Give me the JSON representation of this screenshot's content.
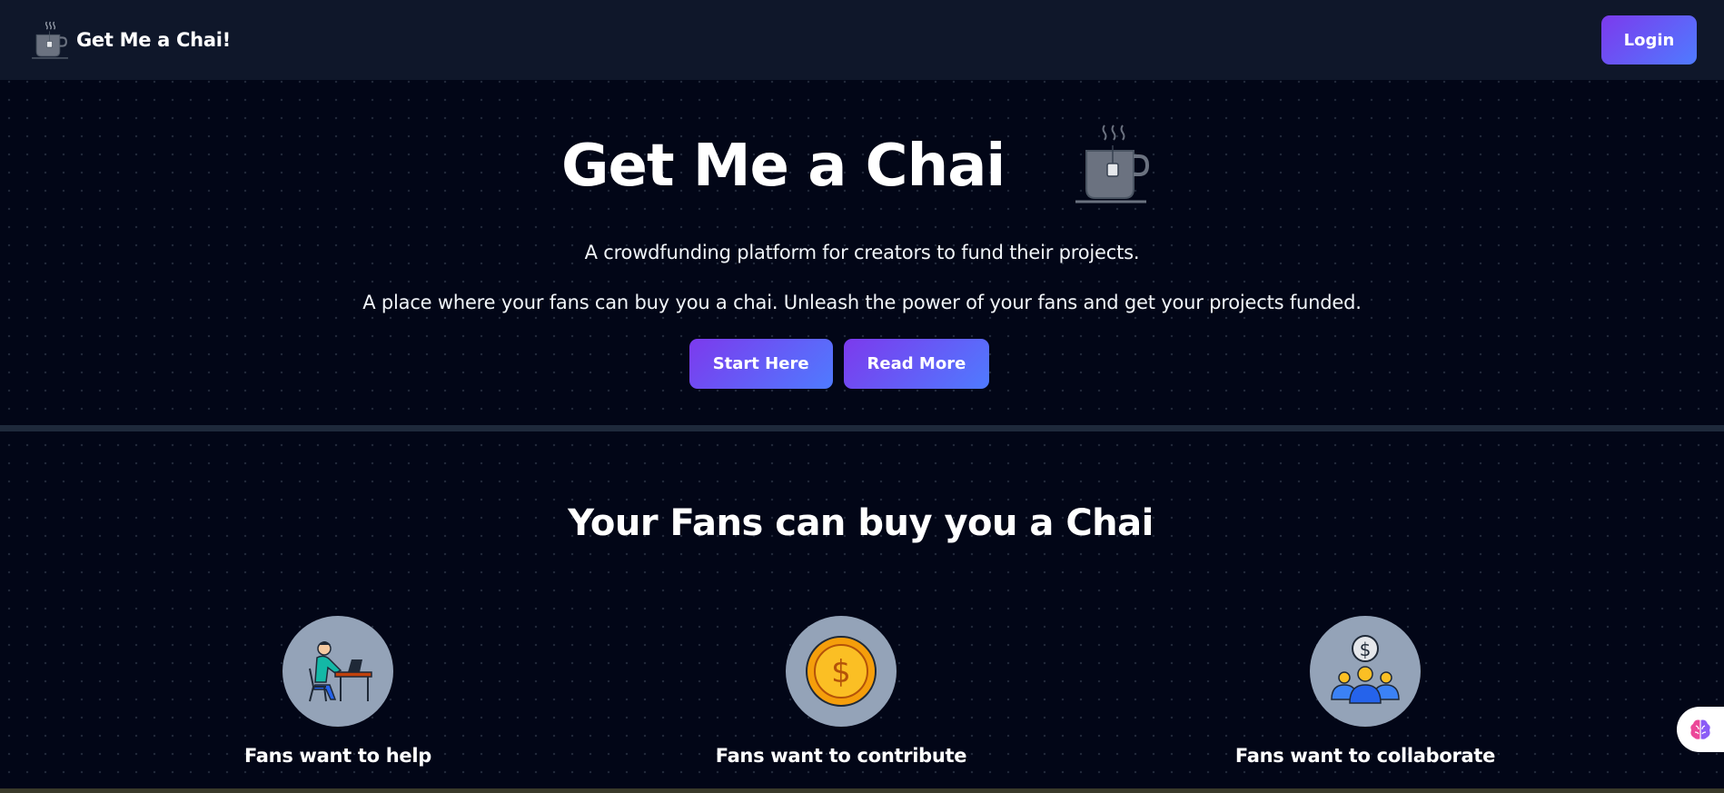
{
  "navbar": {
    "brand_name": "Get Me a Chai!",
    "brand_icon": "tea-cup-icon",
    "login_label": "Login"
  },
  "hero": {
    "title": "Get Me a Chai",
    "icon": "tea-cup-icon",
    "subtitle": "A crowdfunding platform for creators to fund their projects.",
    "description": "A place where your fans can buy you a chai. Unleash the power of your fans and get your projects funded.",
    "buttons": [
      {
        "label": "Start Here"
      },
      {
        "label": "Read More"
      }
    ]
  },
  "section": {
    "title": "Your Fans can buy you a Chai",
    "features": [
      {
        "label": "Fans want to help",
        "icon": "person-at-desk-icon"
      },
      {
        "label": "Fans want to contribute",
        "icon": "dollar-coin-icon"
      },
      {
        "label": "Fans want to collaborate",
        "icon": "group-dollar-icon"
      }
    ]
  },
  "widget": {
    "icon": "brain-icon"
  },
  "colors": {
    "background": "#020617",
    "navbar": "#0f172a",
    "button_gradient_start": "#7c3aed",
    "button_gradient_end": "#4f7bff",
    "icon_circle": "#94a3b8"
  }
}
